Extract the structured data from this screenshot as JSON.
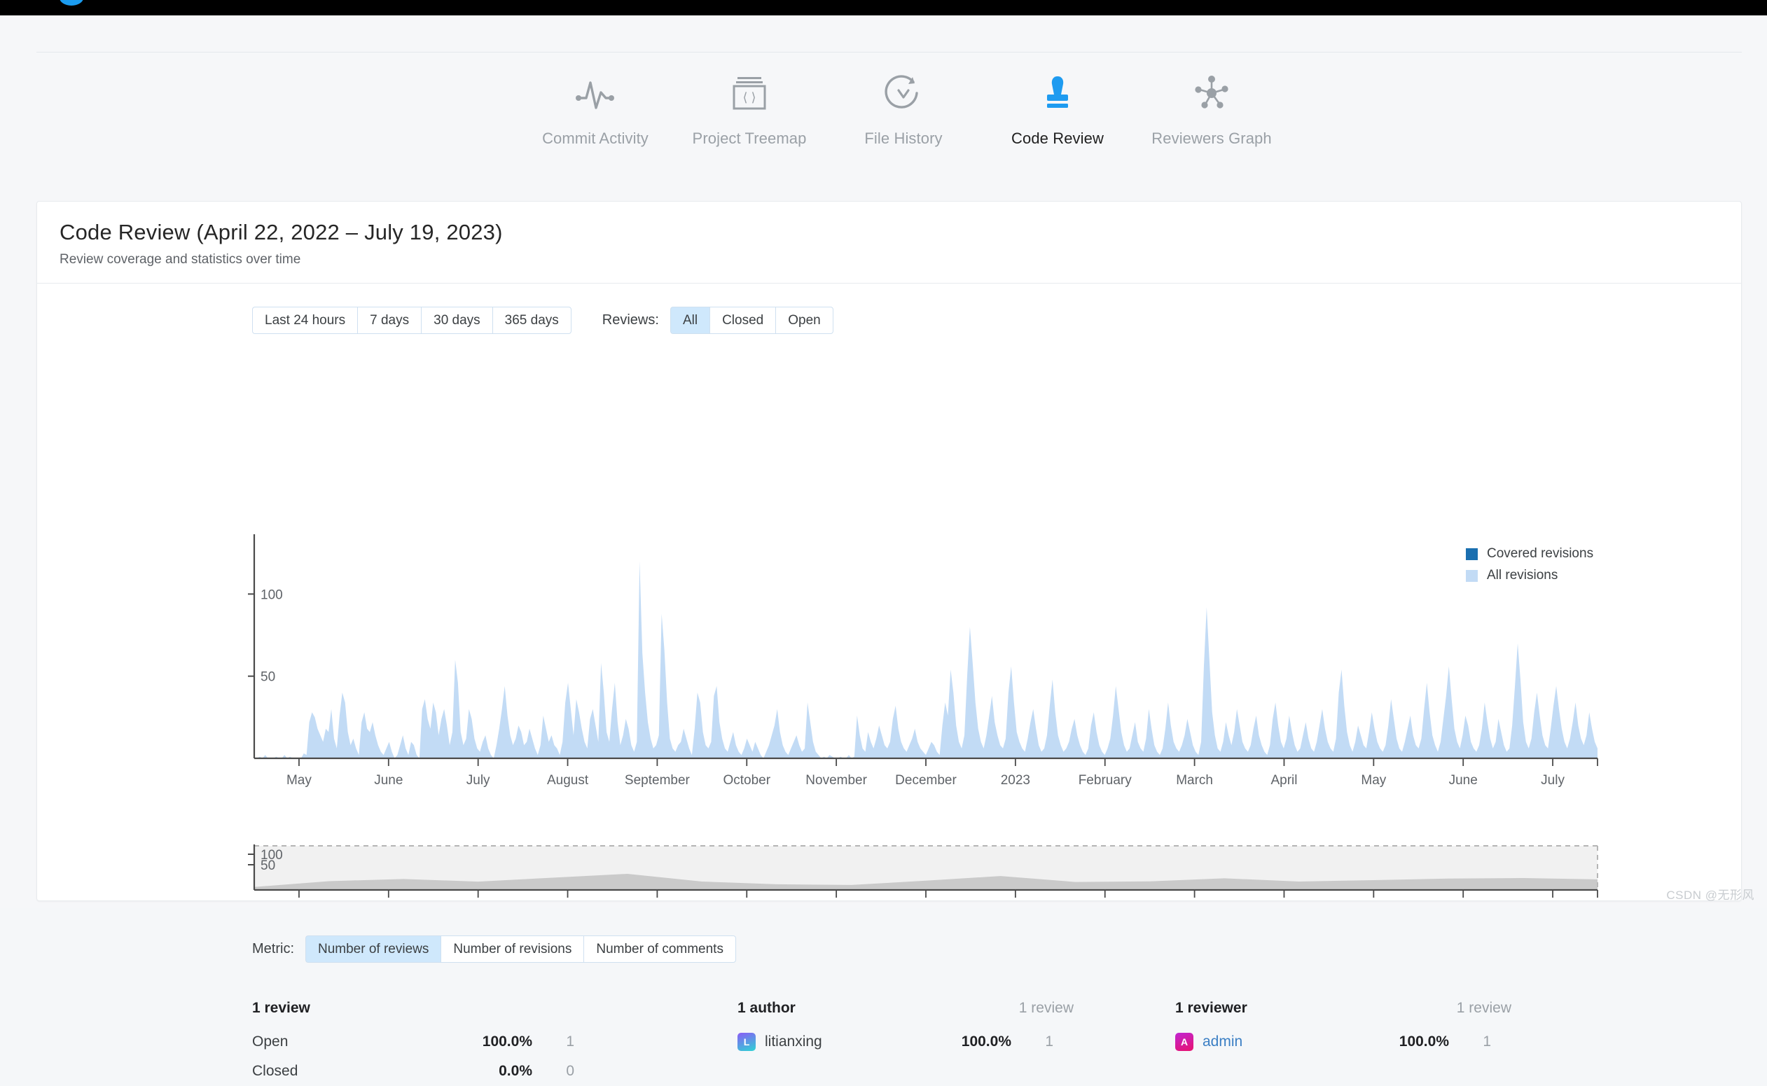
{
  "topbar": {
    "logo_icon": "browser-logo-circle"
  },
  "nav": {
    "items": [
      {
        "label": "Commit Activity",
        "icon": "pulse-icon",
        "active": false
      },
      {
        "label": "Project Treemap",
        "icon": "code-window-icon",
        "active": false
      },
      {
        "label": "File History",
        "icon": "history-clock-icon",
        "active": false
      },
      {
        "label": "Code Review",
        "icon": "stamp-icon",
        "active": true
      },
      {
        "label": "Reviewers Graph",
        "icon": "network-graph-icon",
        "active": false
      }
    ],
    "active_color": "#1e9bf0",
    "inactive_color": "#9aa0a6"
  },
  "card": {
    "title": "Code Review (April 22, 2022 – July 19, 2023)",
    "subtitle": "Review coverage and statistics over time"
  },
  "controls": {
    "range_buttons": [
      {
        "label": "Last 24 hours",
        "selected": false
      },
      {
        "label": "7 days",
        "selected": false
      },
      {
        "label": "30 days",
        "selected": false
      },
      {
        "label": "365 days",
        "selected": false
      }
    ],
    "reviews_label": "Reviews:",
    "reviews_buttons": [
      {
        "label": "All",
        "selected": true
      },
      {
        "label": "Closed",
        "selected": false
      },
      {
        "label": "Open",
        "selected": false
      }
    ],
    "metric_label": "Metric:",
    "metric_buttons": [
      {
        "label": "Number of reviews",
        "selected": true
      },
      {
        "label": "Number of revisions",
        "selected": false
      },
      {
        "label": "Number of comments",
        "selected": false
      }
    ]
  },
  "chart_data": {
    "type": "area",
    "title": "Code Review (April 22, 2022 – July 19, 2023)",
    "xlabel": "",
    "ylabel": "",
    "ylim": [
      0,
      130
    ],
    "yticks": [
      50,
      100
    ],
    "grid": false,
    "legend_position": "top-right",
    "legend": [
      {
        "name": "Covered revisions",
        "color": "#1a6fb0"
      },
      {
        "name": "All revisions",
        "color": "#c2dbf5"
      }
    ],
    "categories": [
      "May",
      "June",
      "July",
      "August",
      "September",
      "October",
      "November",
      "December",
      "2023",
      "February",
      "March",
      "April",
      "May",
      "June",
      "July"
    ],
    "series": [
      {
        "name": "All revisions",
        "color": "#c2dbf5",
        "values": [
          0,
          0,
          1,
          0,
          2,
          0,
          0,
          0,
          1,
          0,
          0,
          2,
          0,
          1,
          0,
          0,
          0,
          0,
          3,
          2,
          22,
          28,
          25,
          18,
          14,
          10,
          18,
          16,
          30,
          12,
          6,
          26,
          40,
          34,
          16,
          8,
          12,
          6,
          2,
          22,
          28,
          18,
          16,
          22,
          14,
          8,
          4,
          2,
          6,
          10,
          4,
          0,
          2,
          8,
          14,
          6,
          2,
          10,
          8,
          2,
          0,
          30,
          36,
          24,
          18,
          34,
          28,
          14,
          24,
          30,
          20,
          8,
          16,
          60,
          46,
          16,
          8,
          12,
          30,
          24,
          12,
          6,
          4,
          10,
          14,
          6,
          2,
          0,
          8,
          18,
          30,
          44,
          26,
          14,
          8,
          12,
          20,
          16,
          8,
          10,
          18,
          12,
          6,
          2,
          8,
          26,
          18,
          10,
          14,
          8,
          6,
          2,
          10,
          34,
          46,
          30,
          14,
          36,
          28,
          18,
          10,
          6,
          24,
          30,
          20,
          10,
          58,
          40,
          16,
          10,
          30,
          46,
          22,
          8,
          14,
          24,
          18,
          8,
          4,
          10,
          120,
          64,
          40,
          22,
          12,
          6,
          8,
          14,
          88,
          66,
          34,
          12,
          6,
          4,
          8,
          10,
          18,
          12,
          6,
          2,
          18,
          40,
          34,
          16,
          8,
          6,
          10,
          38,
          44,
          22,
          12,
          6,
          4,
          10,
          16,
          8,
          4,
          2,
          6,
          12,
          8,
          4,
          10,
          6,
          2,
          0,
          4,
          8,
          14,
          20,
          30,
          16,
          8,
          4,
          2,
          6,
          10,
          14,
          8,
          4,
          6,
          34,
          22,
          10,
          4,
          2,
          0,
          1,
          0,
          2,
          1,
          0,
          0,
          1,
          0,
          0,
          2,
          0,
          1,
          26,
          14,
          6,
          4,
          16,
          10,
          6,
          12,
          20,
          14,
          8,
          6,
          10,
          24,
          32,
          18,
          10,
          6,
          4,
          8,
          12,
          18,
          10,
          6,
          4,
          2,
          6,
          10,
          8,
          4,
          2,
          20,
          34,
          26,
          54,
          40,
          20,
          10,
          6,
          14,
          50,
          80,
          58,
          34,
          18,
          10,
          6,
          14,
          26,
          38,
          22,
          14,
          8,
          6,
          12,
          40,
          56,
          34,
          16,
          10,
          6,
          4,
          12,
          22,
          30,
          18,
          8,
          4,
          6,
          14,
          32,
          48,
          28,
          14,
          8,
          4,
          6,
          10,
          18,
          24,
          14,
          8,
          4,
          2,
          6,
          20,
          28,
          16,
          8,
          4,
          2,
          6,
          12,
          26,
          44,
          30,
          16,
          8,
          4,
          6,
          14,
          22,
          10,
          6,
          4,
          12,
          30,
          18,
          8,
          4,
          2,
          6,
          18,
          34,
          20,
          10,
          6,
          4,
          8,
          14,
          24,
          16,
          8,
          4,
          2,
          10,
          56,
          92,
          60,
          28,
          14,
          6,
          4,
          10,
          22,
          14,
          8,
          16,
          30,
          20,
          10,
          6,
          4,
          8,
          18,
          26,
          14,
          8,
          4,
          2,
          8,
          24,
          34,
          20,
          10,
          6,
          12,
          26,
          16,
          8,
          4,
          6,
          14,
          22,
          12,
          6,
          4,
          10,
          20,
          30,
          18,
          10,
          6,
          4,
          12,
          40,
          54,
          32,
          16,
          8,
          4,
          10,
          20,
          14,
          8,
          6,
          16,
          28,
          18,
          10,
          6,
          4,
          8,
          20,
          36,
          24,
          12,
          6,
          4,
          10,
          18,
          26,
          14,
          8,
          6,
          12,
          30,
          46,
          28,
          14,
          8,
          4,
          10,
          24,
          38,
          56,
          36,
          18,
          10,
          6,
          14,
          26,
          20,
          10,
          6,
          4,
          8,
          18,
          34,
          22,
          12,
          6,
          10,
          24,
          16,
          8,
          4,
          6,
          20,
          44,
          70,
          48,
          22,
          10,
          6,
          12,
          28,
          40,
          26,
          14,
          8,
          6,
          18,
          32,
          44,
          30,
          18,
          10,
          6,
          12,
          22,
          34,
          20,
          12,
          8,
          14,
          28,
          18,
          10,
          6
        ]
      },
      {
        "name": "Covered revisions",
        "color": "#1a6fb0",
        "values": []
      }
    ]
  },
  "minimap": {
    "yticks": [
      50,
      100
    ],
    "categories": [
      "May",
      "June",
      "July",
      "August",
      "September",
      "October",
      "November",
      "December",
      "2023",
      "February",
      "March",
      "April",
      "May",
      "June",
      "July"
    ],
    "brush_selection": "full-range",
    "area_color": "#bcbcbc",
    "selection_fill": "#f1f1f1"
  },
  "stats": {
    "columns": [
      {
        "heading": "1 review",
        "heading_muted": false,
        "rows": [
          {
            "name": "Open",
            "pct": "100.0%",
            "count": "1",
            "avatar": null,
            "link": false
          },
          {
            "name": "Closed",
            "pct": "0.0%",
            "count": "0",
            "avatar": null,
            "link": false
          }
        ]
      },
      {
        "heading": "1 author",
        "heading_muted": false,
        "heading2": "1 review",
        "rows": [
          {
            "name": "litianxing",
            "pct": "100.0%",
            "count": "1",
            "avatar": {
              "letter": "L",
              "from": "#8b5cf6",
              "to": "#2dd4d4"
            },
            "link": false
          }
        ]
      },
      {
        "heading": "1 reviewer",
        "heading_muted": false,
        "heading2": "1 review",
        "rows": [
          {
            "name": "admin",
            "pct": "100.0%",
            "count": "1",
            "avatar": {
              "letter": "A",
              "from": "#c026d3",
              "to": "#e8126e"
            },
            "link": true
          }
        ]
      }
    ]
  },
  "watermark": "CSDN @无形风"
}
